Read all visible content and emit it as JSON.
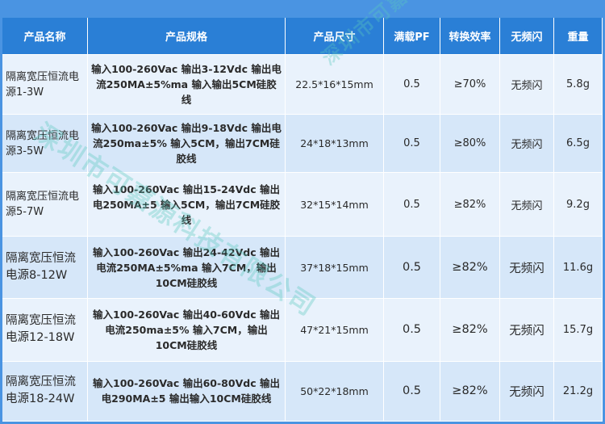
{
  "headers": {
    "name": "产品名称",
    "spec": "产品规格",
    "size": "产品尺寸",
    "pf": "满载PF",
    "efficiency": "转换效率",
    "flicker": "无频闪",
    "weight": "重量"
  },
  "rows": [
    {
      "name": "隔离宽压恒流电源1-3W",
      "spec": "输入100-260Vac 输出3-12Vdc 输出电流250MA±5%ma 输入输出5CM硅胶线",
      "size": "22.5*16*15mm",
      "pf": "0.5",
      "efficiency": "≥70%",
      "flicker": "无频闪",
      "weight": "5.8g"
    },
    {
      "name": "隔离宽压恒流电源3-5W",
      "spec": "输入100-260Vac 输出9-18Vdc 输出电流250ma±5% 输入5CM，输出7CM硅胶线",
      "size": "24*18*13mm",
      "pf": "0.5",
      "efficiency": "≥80%",
      "flicker": "无频闪",
      "weight": "6.5g"
    },
    {
      "name": "隔离宽压恒流电源5-7W",
      "spec": "输入100-260Vac 输出15-24Vdc 输出电250MA±5 输入5CM，输出7CM硅胶线",
      "size": "32*15*14mm",
      "pf": "0.5",
      "efficiency": "≥82%",
      "flicker": "无频闪",
      "weight": "9.2g"
    },
    {
      "name": "隔离宽压恒流电源8-12W",
      "spec": "输入100-260Vac 输出24-42Vdc 输出电流250MA±5%ma 输入7CM，输出10CM硅胶线",
      "size": "37*18*15mm",
      "pf": "0.5",
      "efficiency": "≥82%",
      "flicker": "无频闪",
      "weight": "11.6g"
    },
    {
      "name": "隔离宽压恒流电源12-18W",
      "spec": "输入100-260Vac 输出40-60Vdc 输出电流250ma±5% 输入7CM，输出10CM硅胶线",
      "size": "47*21*15mm",
      "pf": "0.5",
      "efficiency": "≥82%",
      "flicker": "无频闪",
      "weight": "15.7g"
    },
    {
      "name": "隔离宽压恒流电源18-24W",
      "spec": "输入100-260Vac 输出60-80Vdc 输出电290MA±5 输出输入10CM硅胶线",
      "size": "50*22*18mm",
      "pf": "0.5",
      "efficiency": "≥82%",
      "flicker": "无频闪",
      "weight": "21.2g"
    }
  ],
  "watermark": {
    "text1": "深圳市可嘉源科技有限公司",
    "text2": "深圳市可嘉源科技有限公司"
  },
  "colors": {
    "header_bg": "#2a7fd6",
    "row_light": "#e9f2fc",
    "row_alt": "#d6e7f9",
    "frame": "#4a94e2"
  }
}
